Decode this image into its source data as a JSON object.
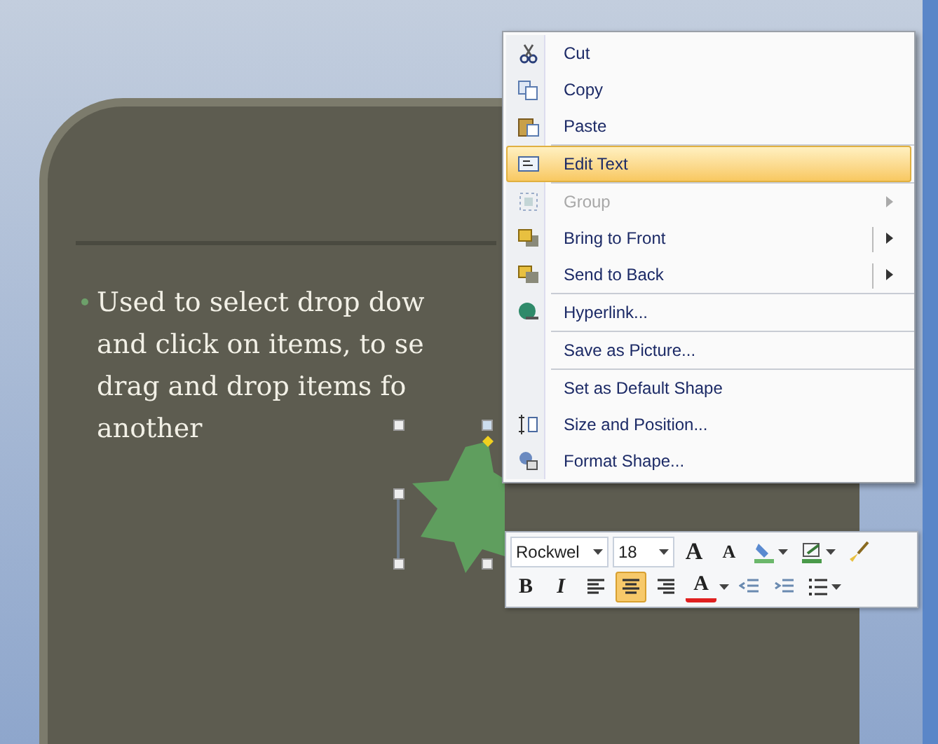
{
  "slide": {
    "bullet_lines": [
      "Used to select drop dow",
      "and click on items, to se",
      "drag and drop items fo",
      "another"
    ]
  },
  "context_menu": {
    "groups": [
      [
        {
          "label": "Cut",
          "selected": false,
          "disabled": false,
          "submenu": false,
          "split": false
        },
        {
          "label": "Copy",
          "selected": false,
          "disabled": false,
          "submenu": false,
          "split": false
        },
        {
          "label": "Paste",
          "selected": false,
          "disabled": false,
          "submenu": false,
          "split": false
        }
      ],
      [
        {
          "label": "Edit Text",
          "selected": true,
          "disabled": false,
          "submenu": false,
          "split": false
        }
      ],
      [
        {
          "label": "Group",
          "selected": false,
          "disabled": true,
          "submenu": true,
          "split": false
        },
        {
          "label": "Bring to Front",
          "selected": false,
          "disabled": false,
          "submenu": true,
          "split": true
        },
        {
          "label": "Send to Back",
          "selected": false,
          "disabled": false,
          "submenu": true,
          "split": true
        }
      ],
      [
        {
          "label": "Hyperlink...",
          "selected": false,
          "disabled": false,
          "submenu": false,
          "split": false
        }
      ],
      [
        {
          "label": "Save as Picture...",
          "selected": false,
          "disabled": false,
          "submenu": false,
          "split": false
        }
      ],
      [
        {
          "label": "Set as Default Shape",
          "selected": false,
          "disabled": false,
          "submenu": false,
          "split": false
        },
        {
          "label": "Size and Position...",
          "selected": false,
          "disabled": false,
          "submenu": false,
          "split": false
        },
        {
          "label": "Format Shape...",
          "selected": false,
          "disabled": false,
          "submenu": false,
          "split": false
        }
      ]
    ]
  },
  "mini_toolbar": {
    "font": "Rockwel",
    "font_size": "18",
    "row_1": [
      {
        "kind": "text",
        "label": "A",
        "selected": false
      },
      {
        "kind": "text",
        "label": "A",
        "selected": false
      },
      {
        "kind": "icon",
        "selected": false
      },
      {
        "kind": "icon",
        "selected": false
      },
      {
        "kind": "icon",
        "selected": false
      }
    ],
    "row_2": [
      {
        "kind": "text",
        "label": "B",
        "selected": false
      },
      {
        "kind": "text",
        "label": "I",
        "selected": false
      },
      {
        "kind": "icon",
        "selected": false
      },
      {
        "kind": "icon",
        "selected": true
      },
      {
        "kind": "icon",
        "selected": false
      },
      {
        "kind": "text",
        "label": "A",
        "selected": false
      },
      {
        "kind": "icon",
        "selected": false
      },
      {
        "kind": "icon",
        "selected": false
      },
      {
        "kind": "icon",
        "selected": false
      }
    ]
  }
}
